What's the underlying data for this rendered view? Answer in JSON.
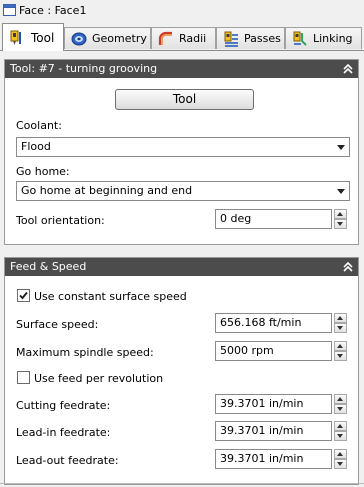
{
  "window": {
    "title": "Face : Face1",
    "icon": "window-icon"
  },
  "tabs": [
    {
      "label": "Tool",
      "icon": "tool-tab-icon",
      "active": true
    },
    {
      "label": "Geometry",
      "icon": "geometry-tab-icon",
      "active": false
    },
    {
      "label": "Radii",
      "icon": "radii-tab-icon",
      "active": false
    },
    {
      "label": "Passes",
      "icon": "passes-tab-icon",
      "active": false
    },
    {
      "label": "Linking",
      "icon": "linking-tab-icon",
      "active": false
    }
  ],
  "tool_section": {
    "header": "Tool: #7 - turning grooving",
    "tool_button_label": "Tool",
    "coolant_label": "Coolant:",
    "coolant_value": "Flood",
    "go_home_label": "Go home:",
    "go_home_value": "Go home at beginning and end",
    "orientation_label": "Tool orientation:",
    "orientation_value": "0 deg"
  },
  "feed_section": {
    "header": "Feed & Speed",
    "constant_speed_label": "Use constant surface speed",
    "constant_speed_checked": true,
    "surface_speed_label": "Surface speed:",
    "surface_speed_value": "656.168 ft/min",
    "max_spindle_label": "Maximum spindle speed:",
    "max_spindle_value": "5000 rpm",
    "feed_per_rev_label": "Use feed per revolution",
    "feed_per_rev_checked": false,
    "cutting_label": "Cutting feedrate:",
    "cutting_value": "39.3701 in/min",
    "leadin_label": "Lead-in feedrate:",
    "leadin_value": "39.3701 in/min",
    "leadout_label": "Lead-out feedrate:",
    "leadout_value": "39.3701 in/min"
  },
  "colors": {
    "section_header_bg": "#4c4c4c",
    "panel_bg": "#ffffff",
    "window_bg": "#f0f0f0",
    "check_mark": "#1a1a1a"
  }
}
